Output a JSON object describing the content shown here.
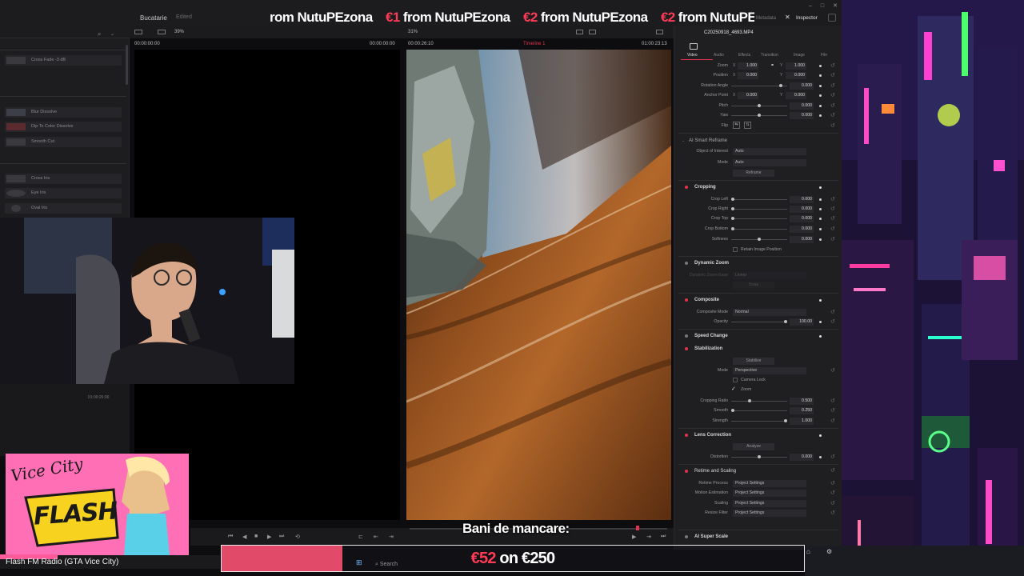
{
  "app": {
    "project_name": "Bucatarie",
    "project_status": "Edited",
    "tabs": {
      "metadata": "Metadata",
      "inspector": "Inspector"
    }
  },
  "ticker": {
    "items": [
      {
        "amount": "",
        "text": "rom NutuPEzona"
      },
      {
        "amount": "€1",
        "text": " from NutuPEzona"
      },
      {
        "amount": "€2",
        "text": " from NutuPEzona"
      },
      {
        "amount": "€2",
        "text": " from NutuPEzona"
      },
      {
        "amount": "€2",
        "text": " from "
      }
    ]
  },
  "effects_panel": {
    "items": [
      {
        "label": "Cross Fade -3 dB"
      },
      {
        "label": "Blur Dissolve"
      },
      {
        "label": "Dip To Color Dissolve"
      },
      {
        "label": "Smooth Cut"
      },
      {
        "label": "Cross Iris"
      },
      {
        "label": "Eye Iris"
      },
      {
        "label": "Oval Iris"
      }
    ],
    "timecode": "01:00:26:00"
  },
  "viewer": {
    "zoom_left": "39%",
    "zoom_right": "31%",
    "tc_left": "00:00:00:00",
    "tc_source": "00:00:00:00",
    "tc_prog_dur": "00:00:26:10",
    "timeline": "Timeline 1",
    "tc_right": "01:00:23:13"
  },
  "inspector": {
    "clip_name": "C20250918_4693.MP4",
    "tabs": [
      "Video",
      "Audio",
      "Effects",
      "Transition",
      "Image",
      "File"
    ],
    "transform": [
      {
        "label": "Zoom",
        "x": "1.000",
        "y": "1.000"
      },
      {
        "label": "Position",
        "x": "0.000",
        "y": "0.000"
      },
      {
        "label": "Rotation Angle",
        "v": "0.000"
      },
      {
        "label": "Anchor Point",
        "x": "0.000",
        "y": "0.000"
      },
      {
        "label": "Pitch",
        "v": "0.000"
      },
      {
        "label": "Yaw",
        "v": "0.000"
      },
      {
        "label": "Flip",
        "v": ""
      }
    ],
    "smart_reframe": {
      "title": "AI Smart Reframe",
      "object_label": "Object of Interest",
      "object_value": "Auto",
      "mode_label": "Mode",
      "mode_value": "Auto",
      "button": "Reframe"
    },
    "cropping": {
      "title": "Cropping",
      "rows": [
        {
          "label": "Crop Left",
          "v": "0.000"
        },
        {
          "label": "Crop Right",
          "v": "0.000"
        },
        {
          "label": "Crop Top",
          "v": "0.000"
        },
        {
          "label": "Crop Bottom",
          "v": "0.000"
        },
        {
          "label": "Softness",
          "v": "0.000"
        }
      ],
      "retain": "Retain Image Position"
    },
    "dynamic_zoom": {
      "title": "Dynamic Zoom",
      "ease_label": "Dynamic Zoom Ease",
      "ease_value": "Linear",
      "swap": "Swap"
    },
    "composite": {
      "title": "Composite",
      "mode_label": "Composite Mode",
      "mode_value": "Normal",
      "opacity_label": "Opacity",
      "opacity_value": "100.00"
    },
    "speed_change": {
      "title": "Speed Change"
    },
    "stabilization": {
      "title": "Stabilization",
      "button": "Stabilize",
      "mode_label": "Mode",
      "mode_value": "Perspective",
      "camera_lock": "Camera Lock",
      "zoom": "Zoom",
      "rows": [
        {
          "label": "Cropping Ratio",
          "v": "0.500"
        },
        {
          "label": "Smooth",
          "v": "0.250"
        },
        {
          "label": "Strength",
          "v": "1.000"
        }
      ]
    },
    "lens_correction": {
      "title": "Lens Correction",
      "button": "Analyze",
      "distortion_label": "Distortion",
      "distortion_value": "0.000"
    },
    "retime": {
      "title": "Retime and Scaling",
      "rows": [
        {
          "label": "Retime Process",
          "v": "Project Settings"
        },
        {
          "label": "Motion Estimation",
          "v": "Project Settings"
        },
        {
          "label": "Scaling",
          "v": "Project Settings"
        },
        {
          "label": "Resize Filter",
          "v": "Project Settings"
        }
      ]
    },
    "super_scale": {
      "title": "AI Super Scale"
    }
  },
  "overlay": {
    "radio_label": "Flash FM Radio (GTA Vice City)",
    "vc_script": "Vice City",
    "vc_flash": "FLASH",
    "goal_title": "Bani de mancare:",
    "goal_current": "€52",
    "goal_on": "on",
    "goal_target": "€250",
    "goal_progress": 0.208
  },
  "taskbar": {
    "search_placeholder": "Search"
  },
  "colors": {
    "accent_red": "#ff3b56",
    "goal_fill": "#e24a6a",
    "vc_pink": "#ff72b8",
    "section_dot": "#e0324a"
  }
}
